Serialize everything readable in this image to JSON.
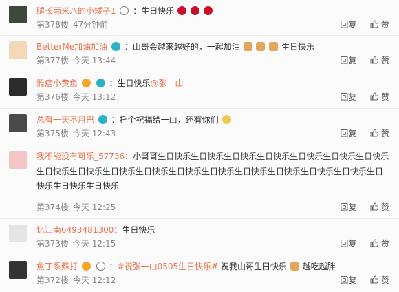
{
  "comments": [
    {
      "username": "腿长两米八的小矮子1",
      "text": "：生日快乐",
      "floor": "第378楼",
      "time": "47分钟前",
      "reply": "回复",
      "like": "赞"
    },
    {
      "username": "BetterMe加油加油",
      "text": "：山哥会越来越好的，一起加油",
      "text_tail": "生日快乐",
      "floor": "第377楼",
      "time": "今天 13:44",
      "reply": "回复",
      "like": "赞"
    },
    {
      "username": "雅痞小黄鱼",
      "text": "：生日快乐",
      "mention": "@张一山",
      "floor": "第376楼",
      "time": "今天 13:12",
      "reply": "回复",
      "like": "赞"
    },
    {
      "username": "总有一天不月巴",
      "text": "：托个祝福给一山，还有你们",
      "floor": "第375楼",
      "time": "今天 12:43",
      "reply": "回复",
      "like": "赞"
    },
    {
      "username": "我不能没有可乐_57736",
      "text": "：小哥哥生日快乐生日快乐生日快乐生日快乐生日快乐生日快乐生日快乐生日快乐生日快乐生日快乐生日快乐生日快乐生日快乐生日快乐生日快乐生日快乐生日快乐生日快乐生日快乐生日快乐",
      "floor": "第374楼",
      "time": "今天 12:25",
      "reply": "回复",
      "like": "赞"
    },
    {
      "username": "忆江南6493481300",
      "text": "：生日快乐",
      "floor": "第373楼",
      "time": "今天 12:15",
      "reply": "回复",
      "like": "赞"
    },
    {
      "username": "魚丁系蘇打",
      "hashtag": "#祝张一山0505生日快乐#",
      "text": "祝我山哥生日快乐",
      "text_tail": "越吃越胖",
      "floor": "第372楼",
      "time": "今天 12:12",
      "reply": "回复",
      "like": "赞"
    }
  ]
}
